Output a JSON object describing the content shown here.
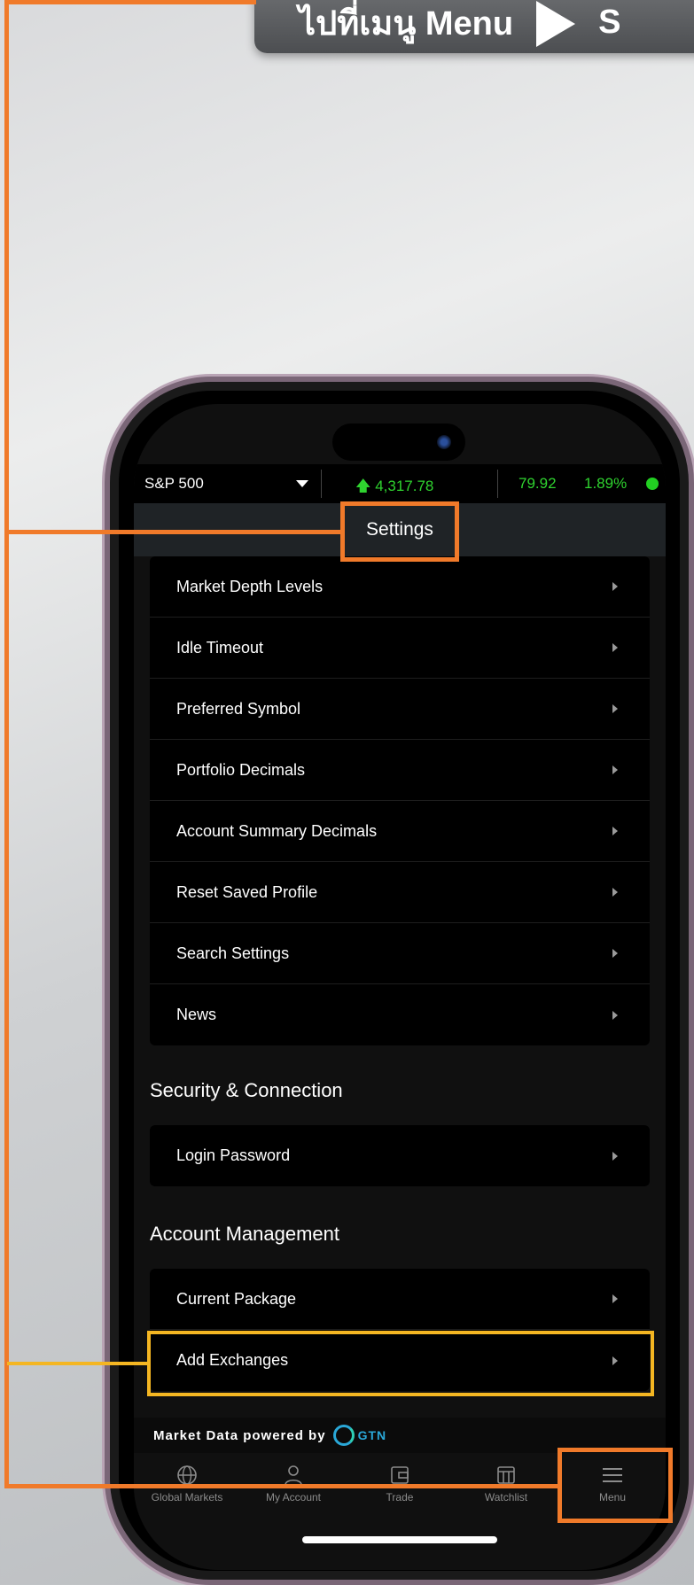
{
  "banner": {
    "text": "ไปที่เมนู Menu",
    "next": "S"
  },
  "ticker": {
    "index_name": "S&P 500",
    "value": "4,317.78",
    "change": "79.92",
    "percent": "1.89%"
  },
  "header": {
    "title": "Settings"
  },
  "settings_items": [
    "Market Depth Levels",
    "Idle Timeout",
    "Preferred Symbol",
    "Portfolio Decimals",
    "Account Summary Decimals",
    "Reset Saved Profile",
    "Search Settings",
    "News"
  ],
  "security": {
    "title": "Security & Connection",
    "items": [
      "Login Password"
    ]
  },
  "account": {
    "title": "Account Management",
    "items": [
      "Current Package",
      "Add Exchanges"
    ]
  },
  "footer": {
    "powered_text": "Market Data powered by",
    "brand": "GTN"
  },
  "tabs": [
    {
      "label": "Global Markets",
      "icon": "globe-icon"
    },
    {
      "label": "My Account",
      "icon": "user-icon"
    },
    {
      "label": "Trade",
      "icon": "wallet-icon"
    },
    {
      "label": "Watchlist",
      "icon": "watchlist-icon"
    },
    {
      "label": "Menu",
      "icon": "menu-icon"
    }
  ],
  "colors": {
    "highlight_orange": "#f07a2a",
    "highlight_yellow": "#f4b622",
    "positive": "#2fd32f"
  }
}
